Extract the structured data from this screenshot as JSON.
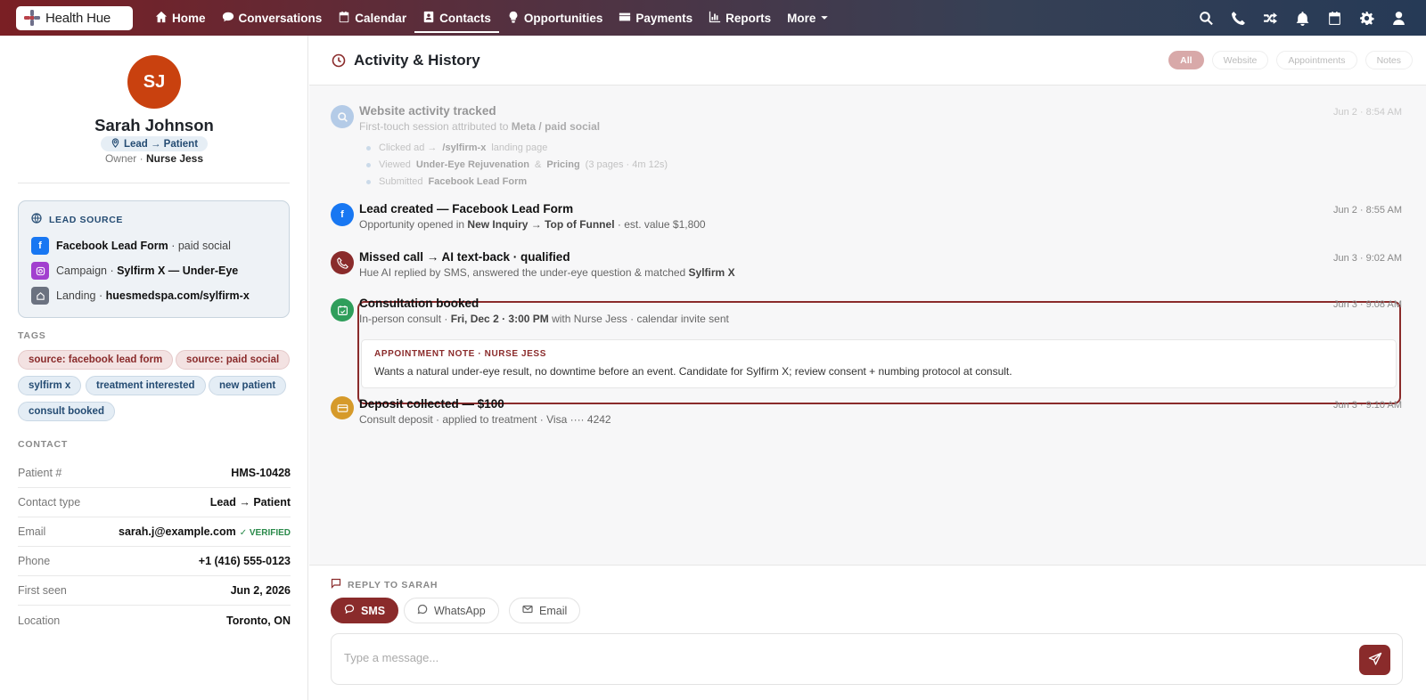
{
  "app": {
    "logo_text": "Health Hue"
  },
  "nav": {
    "items": [
      {
        "label": "Home",
        "icon": "home-icon"
      },
      {
        "label": "Conversations",
        "icon": "chat-icon"
      },
      {
        "label": "Calendar",
        "icon": "calendar-icon"
      },
      {
        "label": "Contacts",
        "icon": "contacts-icon",
        "active": true
      },
      {
        "label": "Opportunities",
        "icon": "lightbulb-icon"
      },
      {
        "label": "Payments",
        "icon": "credit-card-icon"
      },
      {
        "label": "Reports",
        "icon": "chart-icon"
      },
      {
        "label": "More",
        "icon": "chevron-down-icon"
      }
    ],
    "right_icons": [
      "search-icon",
      "phone-icon",
      "shuffle-icon",
      "bell-icon",
      "calendar-icon",
      "gear-icon",
      "user-icon"
    ]
  },
  "contact": {
    "initials": "SJ",
    "name": "Sarah Johnson",
    "stage": "Lead → Patient",
    "owner_label": "Owner ·",
    "owner_name": "Nurse Jess"
  },
  "lead_source": {
    "title": "LEAD SOURCE",
    "rows": [
      {
        "strong": "Facebook Lead Form",
        "rest": " · paid social",
        "icon": "facebook-icon",
        "color": "#1877f2"
      },
      {
        "prefix": "Campaign · ",
        "strong": "Sylfirm X — Under-Eye",
        "icon": "instagram-icon",
        "color": "#a23fcf"
      },
      {
        "prefix": "Landing · ",
        "strong": "huesmedspa.com/sylfirm-x",
        "icon": "landing-page-icon",
        "color": "#6b7280"
      }
    ]
  },
  "tags": {
    "label": "TAGS",
    "items": [
      {
        "label": "source: facebook lead form",
        "color": "red"
      },
      {
        "label": "source: paid social",
        "color": "red"
      },
      {
        "label": "sylfirm x",
        "color": "blue"
      },
      {
        "label": "treatment interested",
        "color": "blue"
      },
      {
        "label": "new patient",
        "color": "blue"
      },
      {
        "label": "consult booked",
        "color": "blue"
      }
    ]
  },
  "contact_info": {
    "label": "CONTACT",
    "rows": [
      {
        "key": "Patient #",
        "value": "HMS-10428"
      },
      {
        "key": "Contact type",
        "value": "Lead → Patient"
      },
      {
        "key": "Email",
        "value": "sarah.j@example.com",
        "badge": "✓ VERIFIED"
      },
      {
        "key": "Phone",
        "value": "+1 (416) 555-0123"
      },
      {
        "key": "First seen",
        "value": "Jun 2, 2026"
      },
      {
        "key": "Location",
        "value": "Toronto, ON"
      }
    ]
  },
  "activity": {
    "title": "Activity & History",
    "filters": [
      "All",
      "Website",
      "Appointments",
      "Notes"
    ],
    "events": [
      {
        "title": "Website activity tracked",
        "sub_a": "First-touch session attributed to ",
        "sub_b": "Meta / paid social",
        "time": "Jun 2 · 8:54 AM",
        "bullets": [
          {
            "a": "Clicked ad →",
            "b": "/sylfirm-x",
            "c": "landing page"
          },
          {
            "a": "Viewed",
            "b": "Under-Eye Rejuvenation",
            "c": "&",
            "d": "Pricing",
            "e": "(3 pages · 4m 12s)"
          },
          {
            "a": "Submitted",
            "b": "Facebook Lead Form"
          }
        ]
      },
      {
        "title": "Lead created — Facebook Lead Form",
        "sub_a": "Opportunity opened in ",
        "sub_b": "New Inquiry → Top of Funnel",
        "sub_c": " · est. value $1,800",
        "time": "Jun 2 · 8:55 AM"
      },
      {
        "title": "Missed call → AI text-back · qualified",
        "sub_a": "Hue AI replied by SMS, answered the under-eye question & matched ",
        "sub_b": "Sylfirm X",
        "time": "Jun 3 · 9:02 AM"
      },
      {
        "title": "Consultation booked",
        "sub_a": "In-person consult · ",
        "sub_b": "Fri, Dec 2 · 3:00 PM",
        "sub_c": " with Nurse Jess · calendar invite sent",
        "time": "Jun 3 · 9:08 AM",
        "note_label": "APPOINTMENT NOTE · NURSE JESS",
        "note_text": "Wants a natural under-eye result, no downtime before an event. Candidate for Sylfirm X; review consent + numbing protocol at consult."
      },
      {
        "title": "Deposit collected — $100",
        "sub_a": "Consult deposit · applied to treatment · Visa ···· 4242",
        "time": "Jun 3 · 9:10 AM"
      }
    ]
  },
  "reply": {
    "label": "REPLY TO SARAH",
    "channels": [
      "SMS",
      "WhatsApp",
      "Email"
    ],
    "placeholder": "Type a message..."
  },
  "colors": {
    "accent": "#8a2b2b",
    "avatar": "#c9410f"
  }
}
